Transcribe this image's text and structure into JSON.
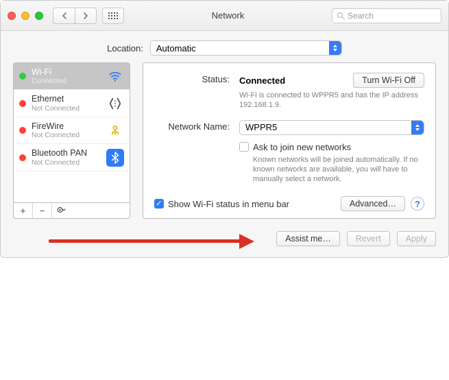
{
  "window": {
    "title": "Network"
  },
  "search": {
    "placeholder": "Search"
  },
  "location": {
    "label": "Location:",
    "selected": "Automatic"
  },
  "sidebar": {
    "items": [
      {
        "name": "Wi-Fi",
        "sub": "Connected",
        "status": "green"
      },
      {
        "name": "Ethernet",
        "sub": "Not Connected",
        "status": "red"
      },
      {
        "name": "FireWire",
        "sub": "Not Connected",
        "status": "red"
      },
      {
        "name": "Bluetooth PAN",
        "sub": "Not Connected",
        "status": "red"
      }
    ]
  },
  "pane": {
    "status_label": "Status:",
    "status_value": "Connected",
    "wifi_off_button": "Turn Wi-Fi Off",
    "status_desc": "Wi-Fi is connected to WPPR5 and has the IP address 192.168.1.9.",
    "network_name_label": "Network Name:",
    "network_name_value": "WPPR5",
    "ask_label": "Ask to join new networks",
    "ask_desc": "Known networks will be joined automatically. If no known networks are available, you will have to manually select a network.",
    "show_menu_label": "Show Wi-Fi status in menu bar",
    "advanced_button": "Advanced…"
  },
  "footer": {
    "assist": "Assist me…",
    "revert": "Revert",
    "apply": "Apply"
  }
}
